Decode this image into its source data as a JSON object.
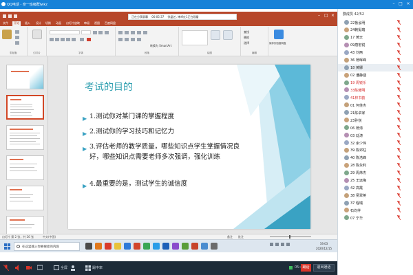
{
  "window": {
    "title": "QQ电话 - 奈一班级群lwkz"
  },
  "share_bar": {
    "sharing_label": "正在分享屏幕",
    "timer": "00:05:37",
    "participant_label": "徐晶艺, 博卓红1正在观看"
  },
  "ppt": {
    "tabs": [
      "文件",
      "开始",
      "插入",
      "设计",
      "切换",
      "动画",
      "幻灯片放映",
      "审阅",
      "视图",
      "百度网盘"
    ],
    "active_tab_index": 1,
    "ribbon": {
      "clipboard_label": "剪贴板",
      "slides_label": "幻灯片",
      "font_label": "字体",
      "paragraph_label": "段落",
      "drawing_label": "绘图",
      "editing_label": "编辑",
      "save_to_baidu": "保存到百度网盘",
      "new_slide": "新建幻灯片",
      "convert_smartart": "转换为 SmartArt",
      "find": "查找",
      "replace": "替换",
      "select": "选择"
    },
    "slide_numbers": [
      "1",
      "2",
      "3",
      "4",
      "5",
      "6"
    ],
    "selected_slide_index": 1,
    "slide": {
      "title": "考试的目的",
      "bullets": [
        "1.测试你对某门课的掌握程度",
        "2.测试你的学习技巧和记忆力",
        "3.评估老师的教学质量，哪些知识点学生掌握情况良好，哪些知识点需要老师多次强调，强化训练",
        "4.最重要的是，测试学生的诚信度"
      ]
    },
    "status": {
      "slide_info": "幻灯片 第 2 张，共 26 张",
      "language": "中文(中国)",
      "notes": "备注",
      "comments": "批注"
    }
  },
  "taskbar": {
    "search_placeholder": "在这里输入你要搜索的内容",
    "time": "19:03",
    "date": "2020/12/15"
  },
  "meeting_toolbar": {
    "items": [
      "全屏",
      "",
      "踢中率"
    ],
    "elapsed": "05:44",
    "raise_hand": "踢话",
    "exit": "退出通话"
  },
  "members": {
    "header": "群成员 42/52",
    "list": [
      {
        "name": "22鲁泓明",
        "red": false
      },
      {
        "name": "24韩挺瑞",
        "red": false
      },
      {
        "name": "17 黄天",
        "red": false
      },
      {
        "name": "09唐宏锐",
        "red": false
      },
      {
        "name": "43 刘两",
        "red": false
      },
      {
        "name": "36 杨晖峰",
        "red": false
      },
      {
        "name": "18 黄娜",
        "red": false,
        "selected": true
      },
      {
        "name": "02 潘静涵",
        "red": false
      },
      {
        "name": "19 周锐乐",
        "red": true
      },
      {
        "name": "33陈耀明",
        "red": true
      },
      {
        "name": "41林书韵",
        "red": true
      },
      {
        "name": "01 何佳杰",
        "red": false
      },
      {
        "name": "21陈卓家",
        "red": false
      },
      {
        "name": "23孙悦",
        "red": false
      },
      {
        "name": "06 杨涛",
        "red": false
      },
      {
        "name": "03 廷涛",
        "red": false
      },
      {
        "name": "32 余少伟",
        "red": false
      },
      {
        "name": "39 陈邓柱",
        "red": false
      },
      {
        "name": "40 陈浩峰",
        "red": false
      },
      {
        "name": "28 陈永利",
        "red": false
      },
      {
        "name": "29 周炜杰",
        "red": false
      },
      {
        "name": "25 王远梅",
        "red": false
      },
      {
        "name": "42 高霞",
        "red": false
      },
      {
        "name": "38 吴翠英",
        "red": false
      },
      {
        "name": "37 程瑞",
        "red": false
      },
      {
        "name": "石均伴",
        "red": false
      },
      {
        "name": "07 宁华",
        "red": false
      }
    ]
  },
  "colors": {
    "ppt_brand": "#b7472a",
    "qq_blue": "#1782d8",
    "slide_title": "#2f9fb0",
    "slide_accent": "#3aa2c3",
    "red_name": "#d62b2b",
    "meeting_bg": "#1d2b38"
  }
}
